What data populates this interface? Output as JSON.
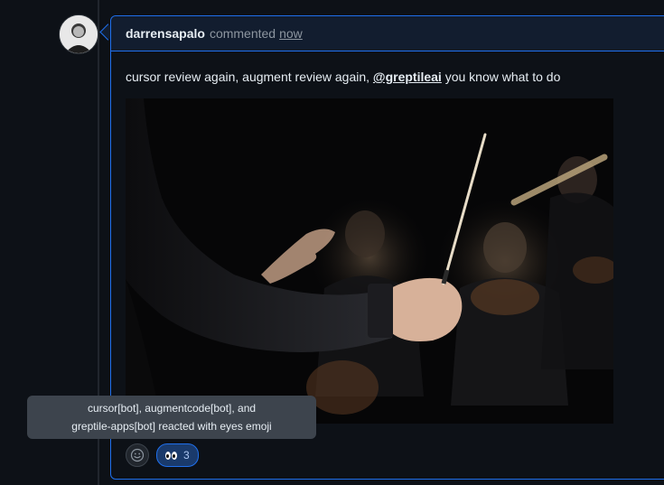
{
  "comment": {
    "author": "darrensapalo",
    "action": "commented",
    "timestamp": "now",
    "body_before": "cursor review again, augment review again, ",
    "mention": "@greptileai",
    "body_after": " you know what to do",
    "image_alt": "conductor-orchestra-photo"
  },
  "reactions": {
    "add_icon": "smiley-icon",
    "items": [
      {
        "emoji": "eyes",
        "count": "3"
      }
    ]
  },
  "tooltip": {
    "line1": "cursor[bot], augmentcode[bot], and",
    "line2": "greptile-apps[bot] reacted with eyes emoji"
  },
  "colors": {
    "accent_border": "#1f6feb",
    "header_bg": "#121d2f",
    "page_bg": "#0d1117",
    "tooltip_bg": "#3d444d",
    "reaction_bg": "#1a3a6b"
  }
}
